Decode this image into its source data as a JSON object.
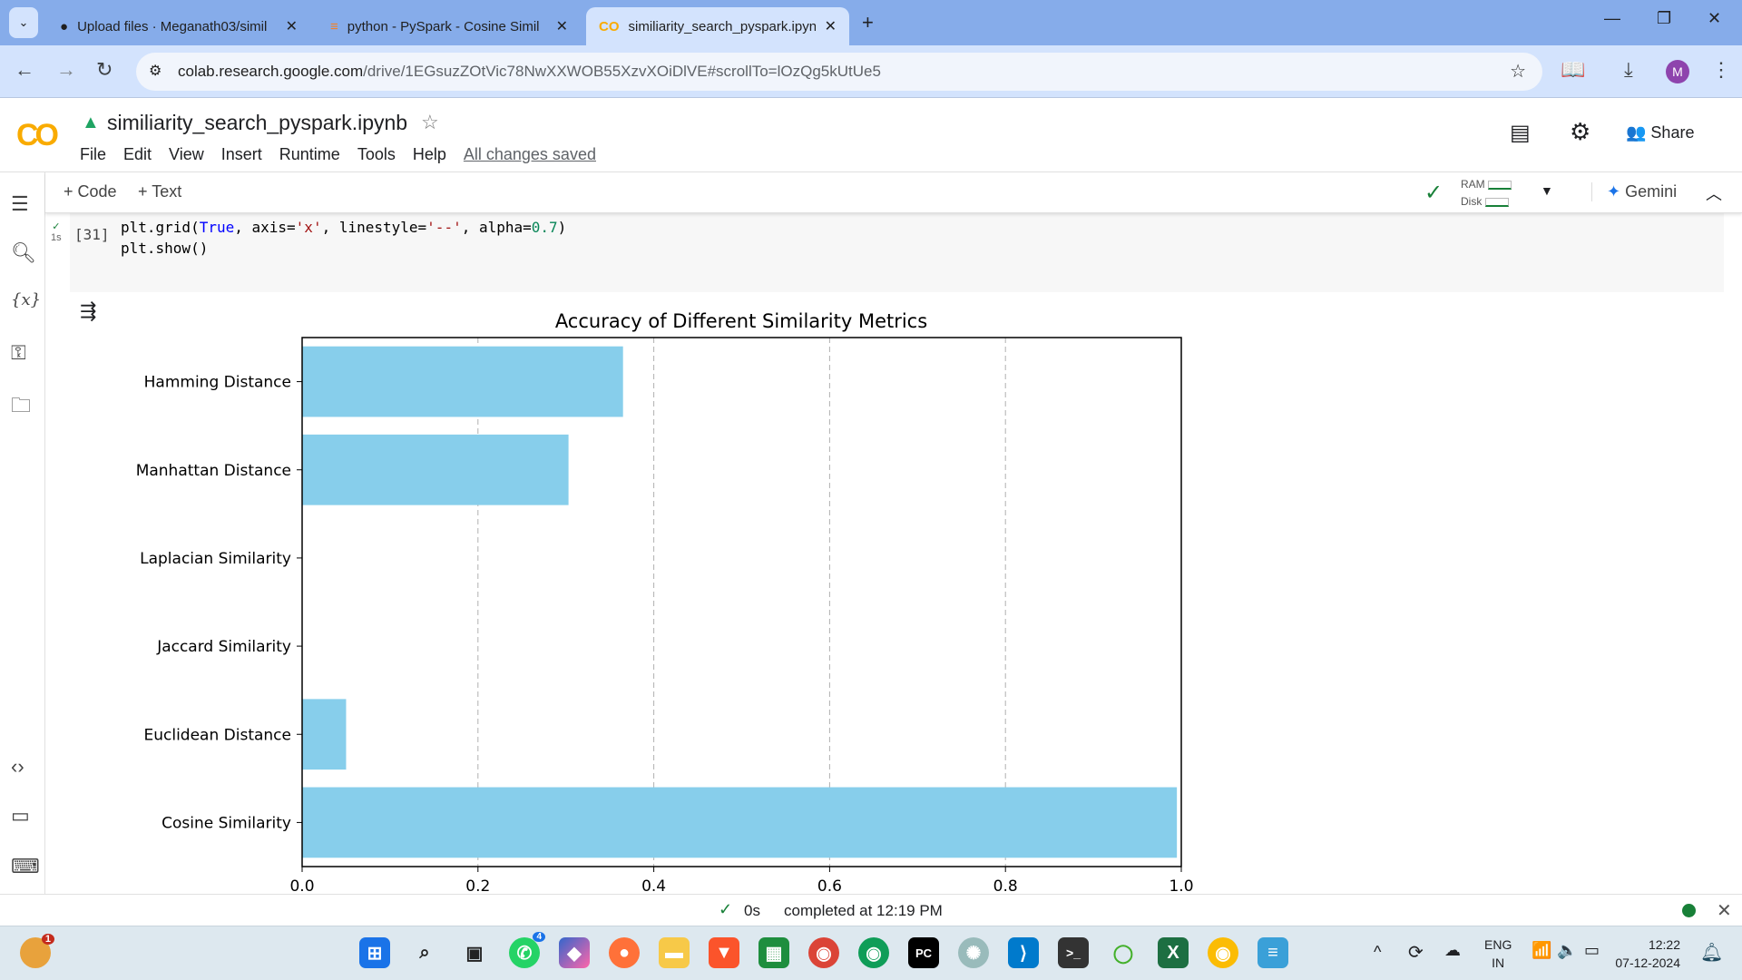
{
  "browser": {
    "tabs": [
      {
        "title": "Upload files · Meganath03/simil",
        "icon": "github-icon"
      },
      {
        "title": "python - PySpark - Cosine Simil",
        "icon": "stackoverflow-icon"
      },
      {
        "title": "similiarity_search_pyspark.ipynb",
        "icon": "colab-icon",
        "active": true
      }
    ],
    "url_host": "colab.research.google.com",
    "url_path": "/drive/1EGsuzZOtVic78NwXXWOB55XzvXOiDlVE#scrollTo=lOzQg5kUtUe5",
    "profile_initial": "M"
  },
  "colab": {
    "logo": "CO",
    "notebook_title": "similiarity_search_pyspark.ipynb",
    "menu": [
      "File",
      "Edit",
      "View",
      "Insert",
      "Runtime",
      "Tools",
      "Help"
    ],
    "saved_status": "All changes saved",
    "share_label": "Share",
    "add_code": "+ Code",
    "add_text": "+ Text",
    "ram_label": "RAM",
    "disk_label": "Disk",
    "gemini_label": "Gemini"
  },
  "cell": {
    "exec_count": "[31]",
    "exec_time": "1s"
  },
  "status": {
    "duration": "0s",
    "completed": "completed at 12:19 PM"
  },
  "taskbar": {
    "lang1": "ENG",
    "lang2": "IN",
    "time": "12:22",
    "date": "07-12-2024",
    "badge_count": "1",
    "whatsapp_badge": "4"
  },
  "chart_data": {
    "type": "bar",
    "orientation": "horizontal",
    "title": "Accuracy of Different Similarity Metrics",
    "categories": [
      "Hamming Distance",
      "Manhattan Distance",
      "Laplacian Similarity",
      "Jaccard Similarity",
      "Euclidean Distance",
      "Cosine Similarity"
    ],
    "values": [
      0.365,
      0.303,
      0,
      0,
      0.05,
      0.995
    ],
    "xlim": [
      0,
      1.0
    ],
    "xticks": [
      "0.0",
      "0.2",
      "0.4",
      "0.6",
      "0.8",
      "1.0"
    ],
    "grid": "x dashed",
    "color": "#87ceeb"
  }
}
